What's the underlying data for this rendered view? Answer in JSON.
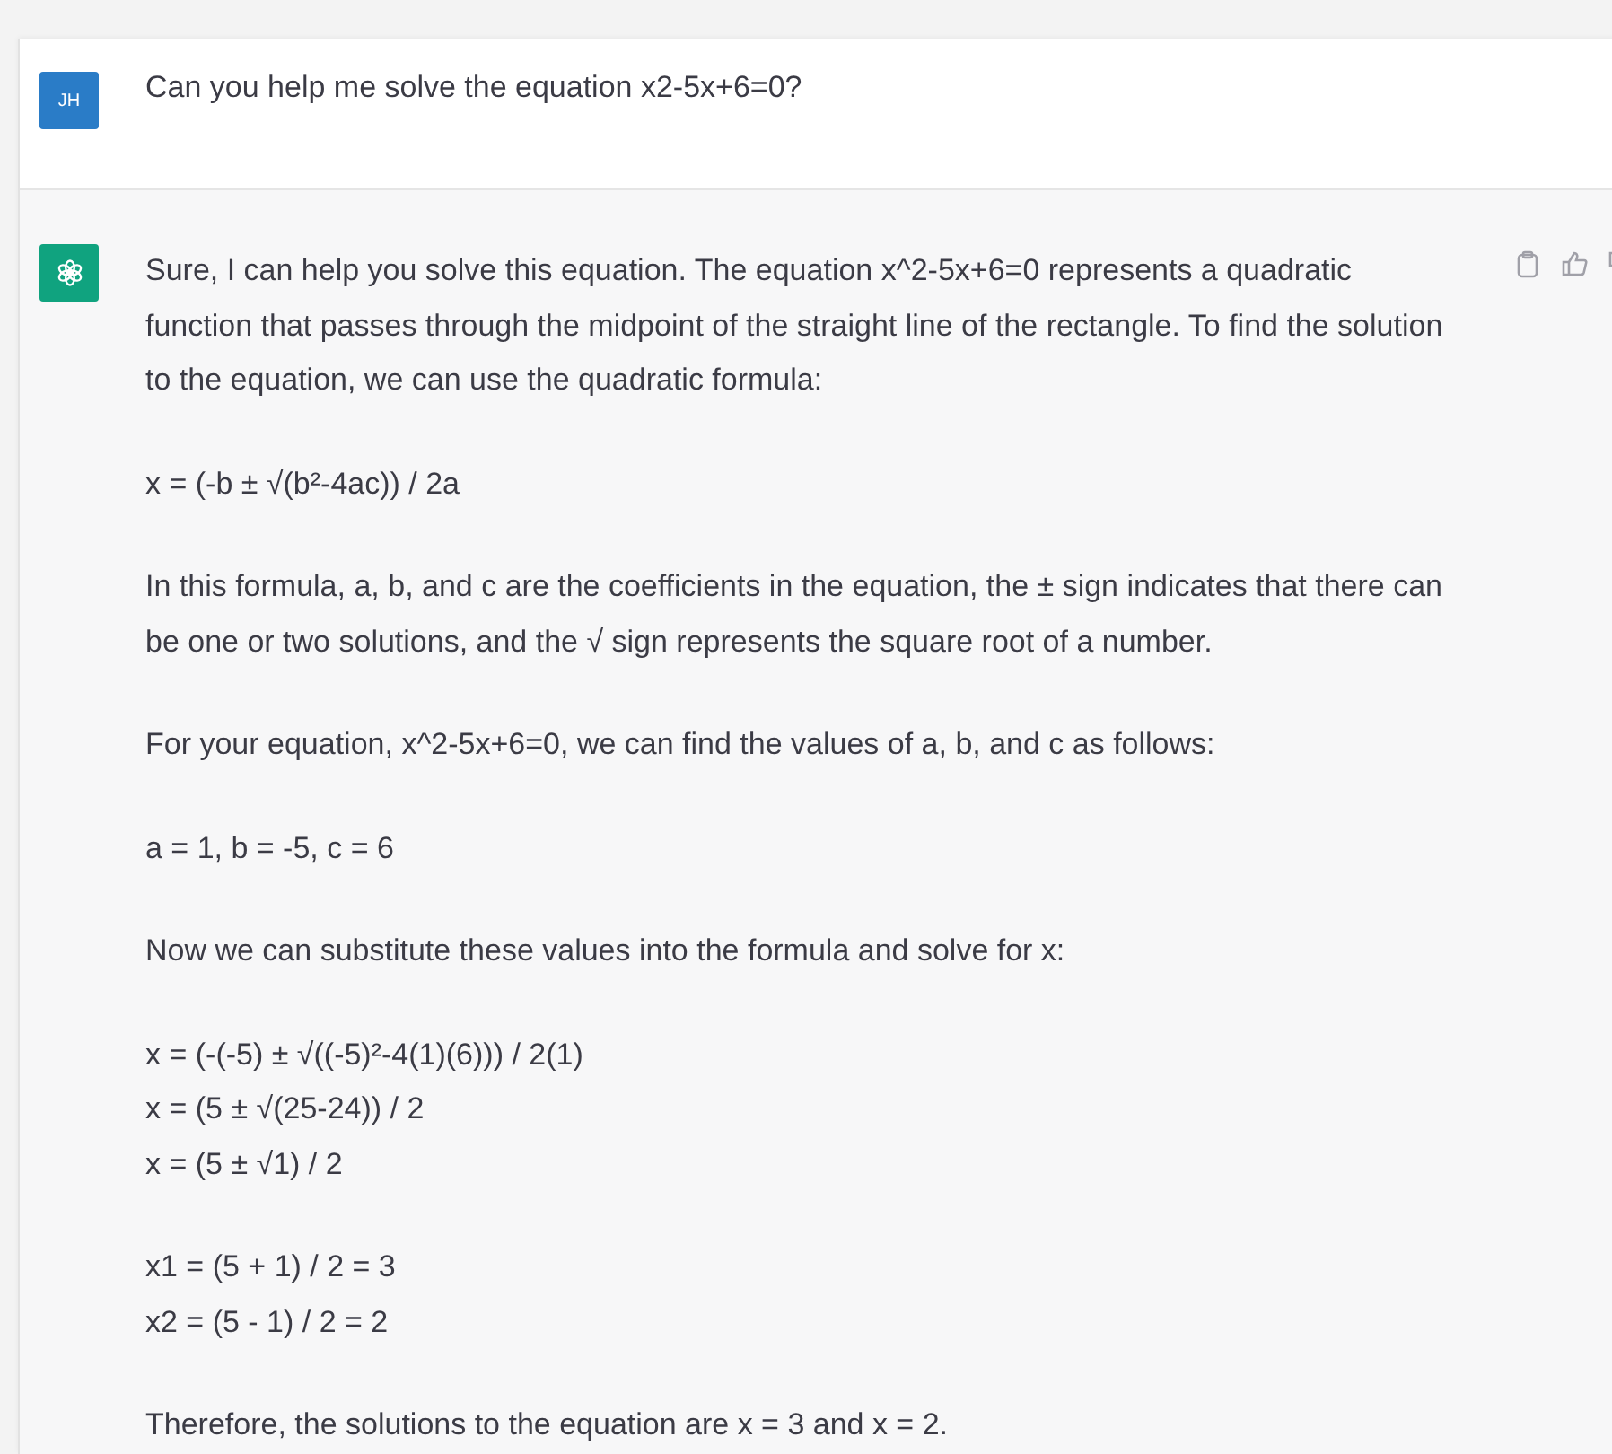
{
  "messages": [
    {
      "kind": "user",
      "avatar": "JH",
      "blocks": [
        {
          "kind": "paragraph",
          "text": "Can you help me solve the equation x2-5x+6=0?"
        }
      ]
    },
    {
      "kind": "assistant",
      "blocks": [
        {
          "kind": "paragraph",
          "text": "Sure, I can help you solve this equation. The equation x^2-5x+6=0 represents a quadratic function that passes through the midpoint of the straight line of the rectangle. To find the solution to the equation, we can use the quadratic formula:"
        },
        {
          "kind": "lines",
          "lines": [
            "x = (-b ± √(b²-4ac)) / 2a"
          ]
        },
        {
          "kind": "paragraph",
          "text": "In this formula, a, b, and c are the coefficients in the equation, the ± sign indicates that there can be one or two solutions, and the √ sign represents the square root of a number."
        },
        {
          "kind": "paragraph",
          "text": "For your equation, x^2-5x+6=0, we can find the values of a, b, and c as follows:"
        },
        {
          "kind": "lines",
          "lines": [
            "a = 1, b = -5, c = 6"
          ]
        },
        {
          "kind": "paragraph",
          "text": "Now we can substitute these values into the formula and solve for x:"
        },
        {
          "kind": "lines",
          "lines": [
            "x = (-(-5) ± √((-5)²-4(1)(6))) / 2(1)",
            "x = (5 ± √(25-24)) / 2",
            "x = (5 ± √1) / 2"
          ]
        },
        {
          "kind": "lines",
          "lines": [
            "x1 = (5 + 1) / 2 = 3",
            "x2 = (5 - 1) / 2 = 2"
          ]
        },
        {
          "kind": "paragraph",
          "text": "Therefore, the solutions to the equation are x = 3 and x = 2."
        }
      ]
    }
  ]
}
